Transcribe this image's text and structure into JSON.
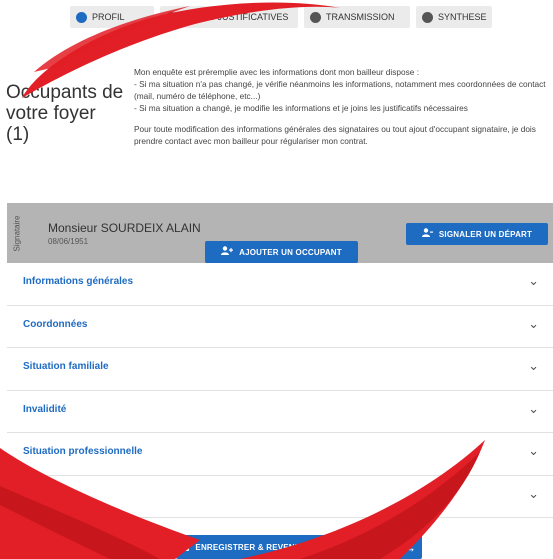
{
  "stepper": {
    "steps": [
      {
        "label": "PROFIL",
        "active": true
      },
      {
        "label": "PIÈCES JUSTIFICATIVES",
        "active": false
      },
      {
        "label": "TRANSMISSION",
        "active": false
      },
      {
        "label": "SYNTHESE",
        "active": false
      }
    ]
  },
  "page": {
    "title": "Occupants de votre foyer (1)"
  },
  "intro": {
    "line1": "Mon enquête est préremplie avec les informations dont mon bailleur dispose :",
    "line2": "- Si ma situation n'a pas changé, je vérifie néanmoins les informations, notamment mes coordonnées de contact (mail, numéro de téléphone, etc...)",
    "line3": "- Si ma situation a changé, je modifie les informations et je joins les justificatifs nécessaires",
    "line4": "Pour toute modification des informations générales des signataires ou tout ajout d'occupant signataire, je dois prendre contact avec mon bailleur pour régulariser mon contrat."
  },
  "signer": {
    "role": "Signataire",
    "name": "Monsieur SOURDEIX ALAIN",
    "birthdate": "08/06/1951",
    "depart_label": "SIGNALER UN DÉPART"
  },
  "actions": {
    "add_occupant_label": "AJOUTER UN OCCUPANT"
  },
  "sections": [
    "Informations générales",
    "Coordonnées",
    "Situation familiale",
    "Invalidité",
    "Situation professionnelle",
    "Ressources"
  ],
  "bottom": {
    "save_label": "ENREGISTRER & REVENIR PLUS TARD"
  },
  "colors": {
    "primary": "#1e6bc2",
    "card": "#b4b4b4",
    "decoration": "#e21e26"
  }
}
